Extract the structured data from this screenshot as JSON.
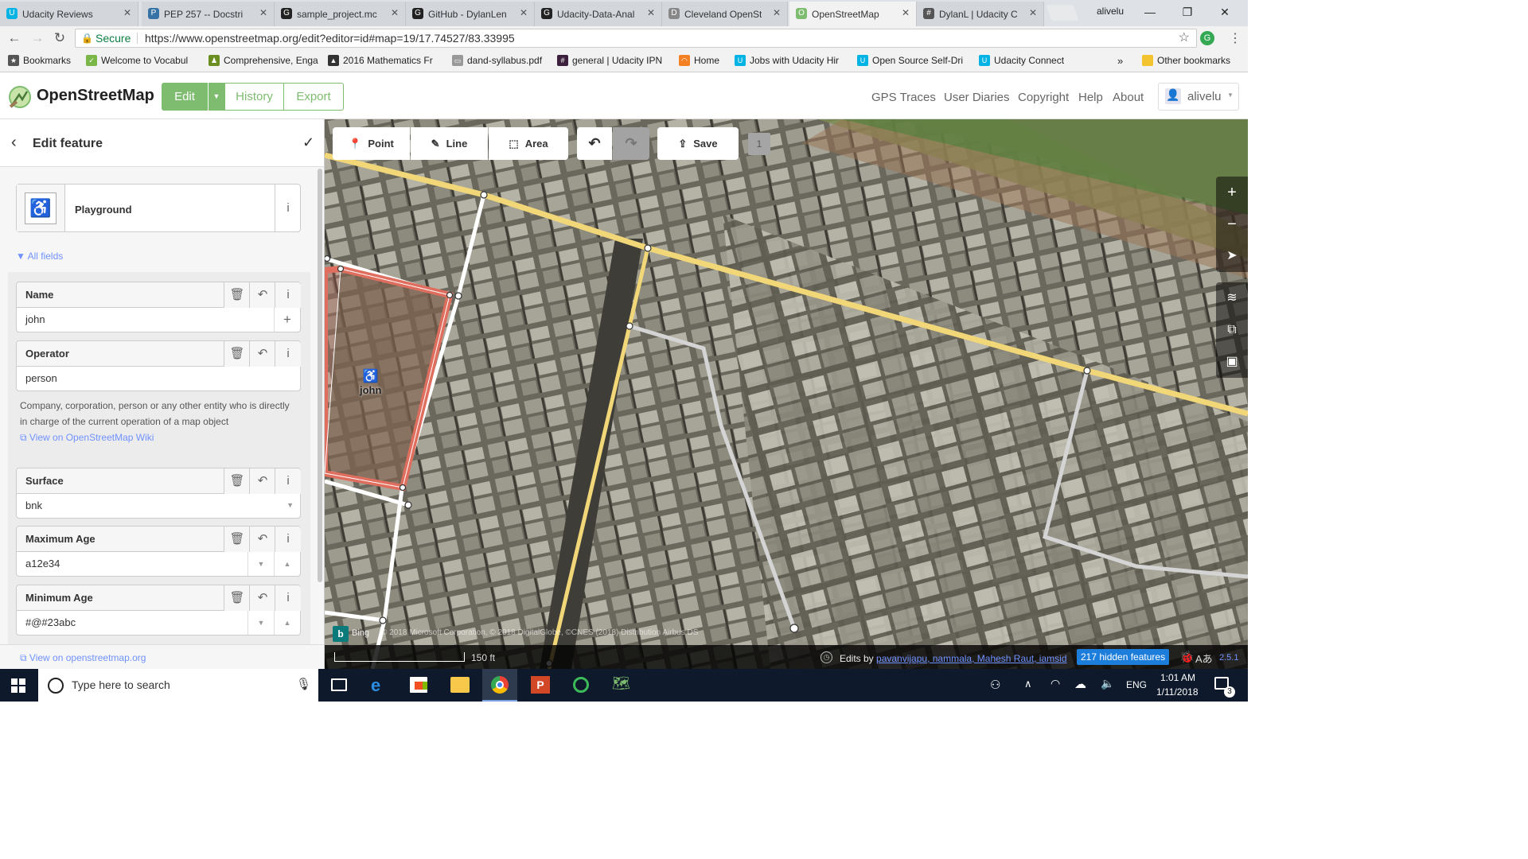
{
  "browser": {
    "tabs": [
      {
        "title": "Udacity Reviews",
        "fav": "U",
        "color": "#02b3e4",
        "active": false
      },
      {
        "title": "PEP 257 -- Docstri",
        "fav": "P",
        "color": "#3572a5",
        "active": false
      },
      {
        "title": "sample_project.mc",
        "fav": "G",
        "color": "#222",
        "active": false
      },
      {
        "title": "GitHub - DylanLen",
        "fav": "G",
        "color": "#222",
        "active": false
      },
      {
        "title": "Udacity-Data-Anal",
        "fav": "G",
        "color": "#222",
        "active": false
      },
      {
        "title": "Cleveland OpenSt",
        "fav": "D",
        "color": "#888",
        "active": false
      },
      {
        "title": "OpenStreetMap",
        "fav": "O",
        "color": "#7ebc6f",
        "active": true
      },
      {
        "title": "DylanL | Udacity C",
        "fav": "#",
        "color": "#555",
        "active": false
      }
    ],
    "user_label": "alivelu",
    "window_buttons": [
      "—",
      "❐",
      "✕"
    ],
    "secure_label": "Secure",
    "url": "https://www.openstreetmap.org/edit?editor=id#map=19/17.74527/83.33995",
    "bookmarks": [
      {
        "label": "Bookmarks",
        "fav": "★",
        "color": "#555"
      },
      {
        "label": "Welcome to Vocabul",
        "fav": "✓",
        "color": "#7ab648"
      },
      {
        "label": "Comprehensive, Enga",
        "fav": "♟",
        "color": "#6b8e23"
      },
      {
        "label": "2016 Mathematics Fr",
        "fav": "▲",
        "color": "#333"
      },
      {
        "label": "dand-syllabus.pdf",
        "fav": "▭",
        "color": "#999"
      },
      {
        "label": "general | Udacity IPN",
        "fav": "#",
        "color": "#3b1f3b"
      },
      {
        "label": "Home",
        "fav": "◠",
        "color": "#f48024"
      },
      {
        "label": "Jobs with Udacity Hir",
        "fav": "U",
        "color": "#02b3e4"
      },
      {
        "label": "Open Source Self-Dri",
        "fav": "U",
        "color": "#02b3e4"
      },
      {
        "label": "Udacity Connect",
        "fav": "U",
        "color": "#02b3e4"
      }
    ],
    "bookmarks_more": "»",
    "other_bookmarks": "Other bookmarks"
  },
  "osm_header": {
    "brand": "OpenStreetMap",
    "edit_label": "Edit",
    "history_label": "History",
    "export_label": "Export",
    "nav": [
      "GPS Traces",
      "User Diaries",
      "Copyright",
      "Help",
      "About"
    ],
    "username": "alivelu"
  },
  "sidebar": {
    "title": "Edit feature",
    "preset_name": "Playground",
    "all_fields_label": "All fields",
    "fields": [
      {
        "label": "Name",
        "value": "john",
        "kind": "text-plus"
      },
      {
        "label": "Operator",
        "value": "person",
        "kind": "text"
      },
      {
        "label": "Surface",
        "value": "bnk",
        "kind": "combo"
      },
      {
        "label": "Maximum Age",
        "value": "a12e34",
        "kind": "number"
      },
      {
        "label": "Minimum Age",
        "value": "#@#23abc",
        "kind": "number"
      }
    ],
    "operator_help": "Company, corporation, person or any other entity who is directly in charge of the current operation of a map object",
    "wiki_link": "View on OpenStreetMap Wiki",
    "footer_link": "View on openstreetmap.org"
  },
  "map": {
    "toolbar": {
      "point": "Point",
      "line": "Line",
      "area": "Area",
      "save": "Save",
      "save_count": "1"
    },
    "feature_label": "john",
    "imagery_source": "Bing",
    "attribution": "© 2018 Microsoft Corporation, © 2018 DigitalGlobe, ©CNES (2018) Distribution Airbus DS",
    "scale_label": "150 ft",
    "edits_by_label": "Edits by",
    "edits_by_users": "pavanvijapu, nammala, Mahesh Raut, iamsid",
    "hidden_features": "217 hidden features",
    "version": "2.5.1",
    "colors": {
      "selected_area": "#e06e5f",
      "residential_road": "#ffffff",
      "major_road": "#fce8a4",
      "footway": "#d4d4d4"
    }
  },
  "taskbar": {
    "search_placeholder": "Type here to search",
    "language": "ENG",
    "time": "1:01 AM",
    "date": "1/11/2018",
    "notification_count": "3"
  }
}
